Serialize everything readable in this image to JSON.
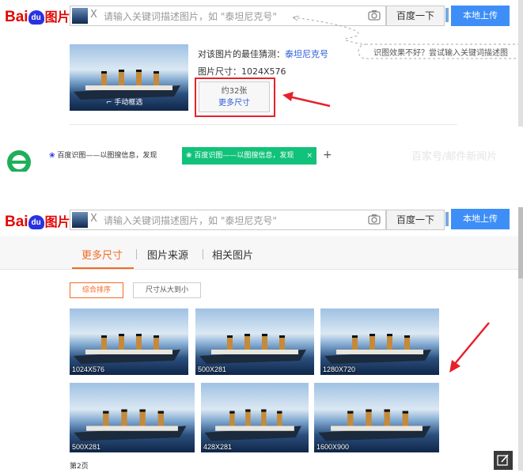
{
  "logo": {
    "bai": "Bai",
    "du": "du",
    "tu": "图片"
  },
  "search": {
    "clear": "X",
    "placeholder": "请输入关键词描述图片，如 \"泰坦尼克号\"",
    "baidu_btn": "百度一下",
    "upload_btn": "本地上传"
  },
  "top_result": {
    "guess_label": "对该图片的最佳猜测：",
    "guess_value": "泰坦尼克号",
    "size_label": "图片尺寸：1024X576",
    "crop_label": "手动框选",
    "more_count": "约32张",
    "more_sizes": "更多尺寸",
    "hint": "识图效果不好？尝试输入关键词描述图"
  },
  "browser_tabs": {
    "tab1": "百度识图——以图搜信息，发现",
    "tab2": "百度识图——以图搜信息，发现",
    "close": "×",
    "add": "+",
    "watermark": "百家号/邮件新闻片"
  },
  "nav_tabs": [
    "更多尺寸",
    "图片来源",
    "相关图片"
  ],
  "sort_buttons": {
    "general": "综合排序",
    "size_desc": "尺寸从大到小"
  },
  "results": [
    {
      "size": "1024X576"
    },
    {
      "size": "500X281"
    },
    {
      "size": "1280X720"
    },
    {
      "size": "500X281"
    },
    {
      "size": "428X281"
    },
    {
      "size": "1600X900"
    }
  ],
  "page_label": "第2页",
  "colors": {
    "brand_red": "#e10602",
    "brand_blue": "#2932e1",
    "accent_blue": "#3e8ef7",
    "tab_orange": "#f36b22",
    "arrow_red": "#e8202a"
  }
}
